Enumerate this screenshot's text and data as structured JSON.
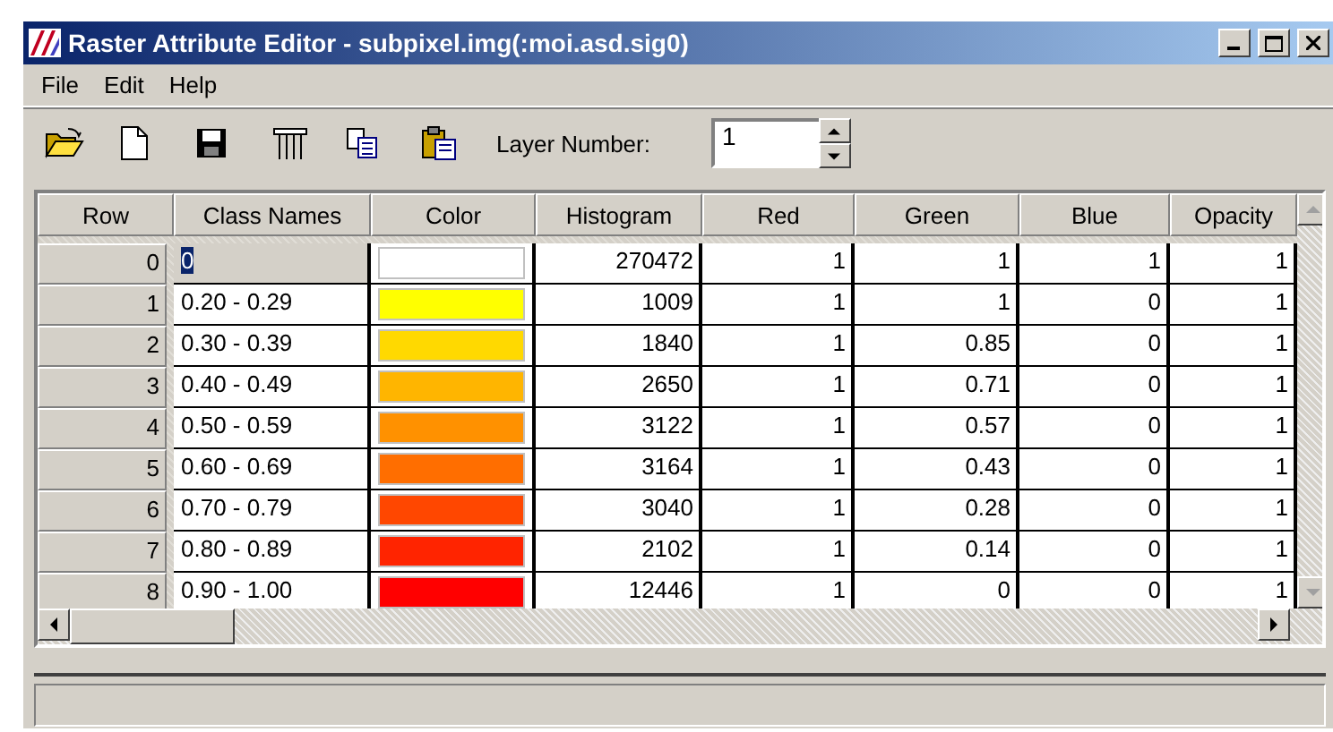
{
  "window": {
    "title": "Raster Attribute Editor - subpixel.img(:moi.asd.sig0)"
  },
  "menu": [
    "File",
    "Edit",
    "Help"
  ],
  "toolbar": {
    "layer_label": "Layer Number:",
    "layer_value": "1"
  },
  "table": {
    "columns": [
      "Row",
      "Class Names",
      "Color",
      "Histogram",
      "Red",
      "Green",
      "Blue",
      "Opacity"
    ],
    "rows": [
      {
        "row": "0",
        "class_name": "0",
        "color": "#ffffff",
        "histogram": "270472",
        "red": "1",
        "green": "1",
        "blue": "1",
        "opacity": "1",
        "selected": true
      },
      {
        "row": "1",
        "class_name": "0.20 - 0.29",
        "color": "#ffff00",
        "histogram": "1009",
        "red": "1",
        "green": "1",
        "blue": "0",
        "opacity": "1",
        "selected": false
      },
      {
        "row": "2",
        "class_name": "0.30 - 0.39",
        "color": "#ffd900",
        "histogram": "1840",
        "red": "1",
        "green": "0.85",
        "blue": "0",
        "opacity": "1",
        "selected": false
      },
      {
        "row": "3",
        "class_name": "0.40 - 0.49",
        "color": "#ffb500",
        "histogram": "2650",
        "red": "1",
        "green": "0.71",
        "blue": "0",
        "opacity": "1",
        "selected": false
      },
      {
        "row": "4",
        "class_name": "0.50 - 0.59",
        "color": "#ff9100",
        "histogram": "3122",
        "red": "1",
        "green": "0.57",
        "blue": "0",
        "opacity": "1",
        "selected": false
      },
      {
        "row": "5",
        "class_name": "0.60 - 0.69",
        "color": "#ff6e00",
        "histogram": "3164",
        "red": "1",
        "green": "0.43",
        "blue": "0",
        "opacity": "1",
        "selected": false
      },
      {
        "row": "6",
        "class_name": "0.70 - 0.79",
        "color": "#ff4700",
        "histogram": "3040",
        "red": "1",
        "green": "0.28",
        "blue": "0",
        "opacity": "1",
        "selected": false
      },
      {
        "row": "7",
        "class_name": "0.80 - 0.89",
        "color": "#ff2400",
        "histogram": "2102",
        "red": "1",
        "green": "0.14",
        "blue": "0",
        "opacity": "1",
        "selected": false
      },
      {
        "row": "8",
        "class_name": "0.90 - 1.00",
        "color": "#ff0000",
        "histogram": "12446",
        "red": "1",
        "green": "0",
        "blue": "0",
        "opacity": "1",
        "selected": false
      }
    ]
  }
}
